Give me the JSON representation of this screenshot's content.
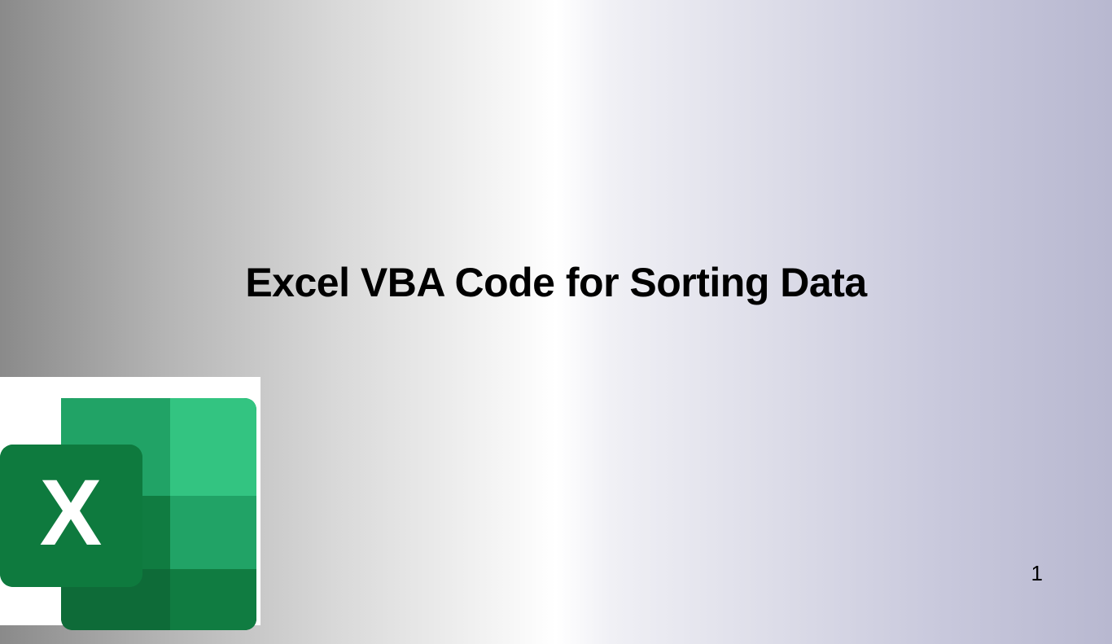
{
  "title": "Excel VBA Code for Sorting Data",
  "page_number": "1",
  "icon": {
    "name": "excel-icon",
    "letter": "X",
    "colors": {
      "dark_green": "#0d7c3f",
      "mid_green": "#27a865",
      "light_green": "#4fbc7e",
      "lighter_green": "#6ecb90",
      "book_dark": "#146a3e",
      "book_mid": "#21a366",
      "book_light": "#33c481"
    }
  }
}
